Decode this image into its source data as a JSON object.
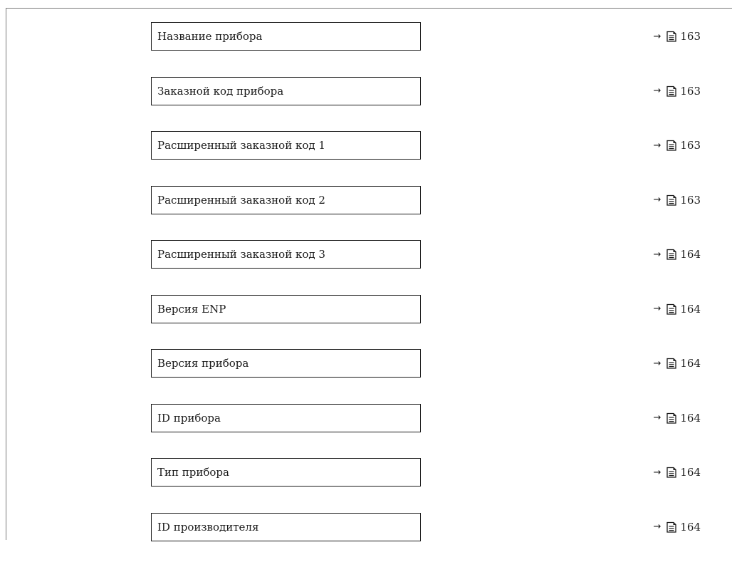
{
  "references": {
    "arrow_glyph": "→",
    "icon": "book-page-icon"
  },
  "parameters": [
    {
      "label": "Название прибора",
      "page": "163"
    },
    {
      "label": "Заказной код прибора",
      "page": "163"
    },
    {
      "label": "Расширенный заказной код 1",
      "page": "163"
    },
    {
      "label": "Расширенный заказной код 2",
      "page": "163"
    },
    {
      "label": "Расширенный заказной код 3",
      "page": "164"
    },
    {
      "label": "Версия ENP",
      "page": "164"
    },
    {
      "label": "Версия прибора",
      "page": "164"
    },
    {
      "label": "ID прибора",
      "page": "164"
    },
    {
      "label": "Тип прибора",
      "page": "164"
    },
    {
      "label": "ID производителя",
      "page": "164"
    }
  ]
}
